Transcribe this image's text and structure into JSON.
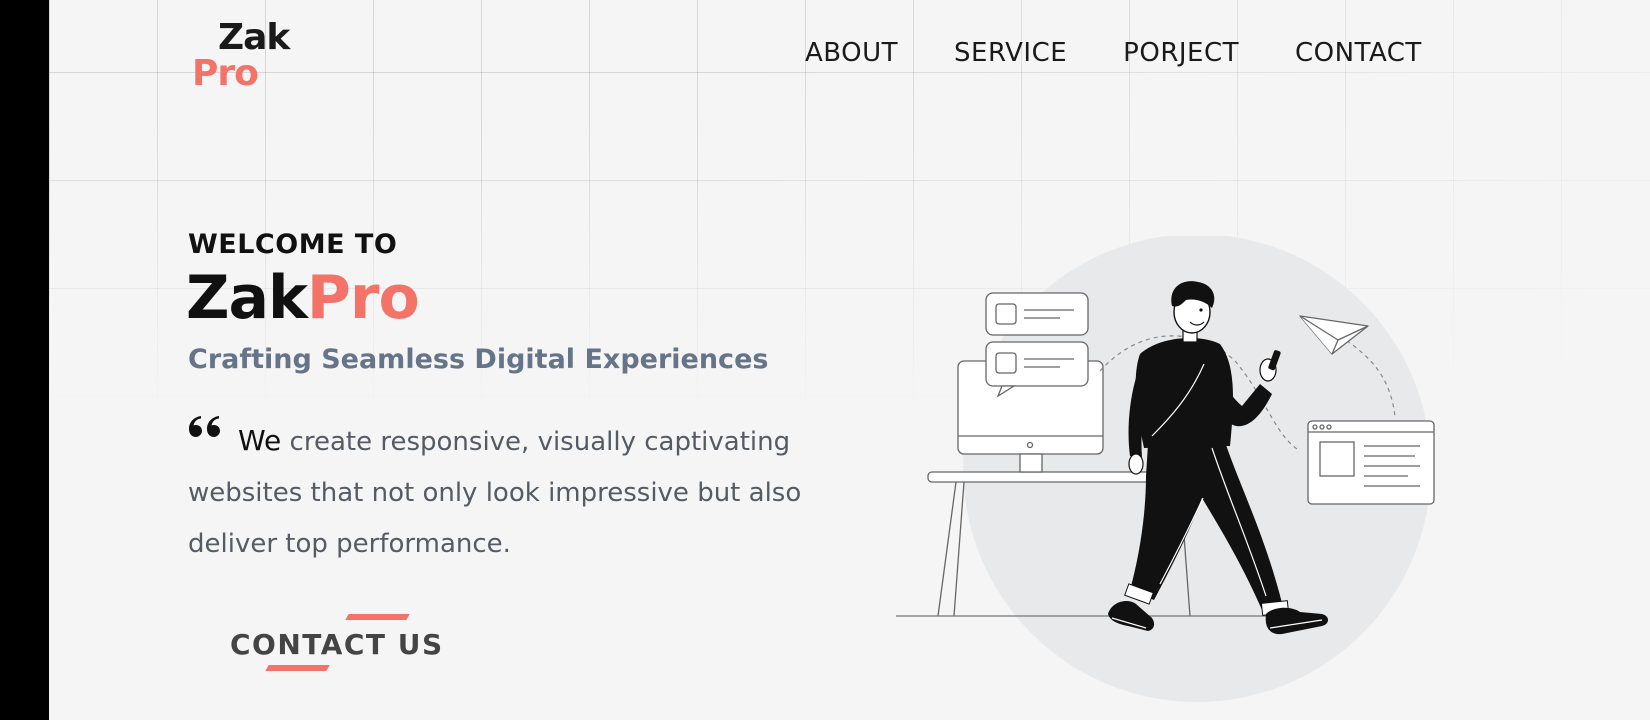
{
  "logo": {
    "line1": "Zak",
    "line2": "Pro",
    "accent_color": "#f37368"
  },
  "nav": {
    "items": [
      {
        "label": "ABOUT"
      },
      {
        "label": "SERVICE"
      },
      {
        "label": "PORJECT"
      },
      {
        "label": "CONTACT"
      }
    ]
  },
  "hero": {
    "welcome": "WELCOME TO",
    "brand_part1": "Zak",
    "brand_part2": "Pro",
    "tagline": "Crafting Seamless Digital Experiences",
    "quote_lead": "We",
    "quote_rest": " create responsive, visually captivating websites that not only look impressive but also deliver top performance.",
    "cta_label": "CONTACT US"
  },
  "colors": {
    "accent": "#f37368",
    "tagline": "#667489",
    "background": "#f5f5f5",
    "left_bar": "#000000"
  },
  "icons": {
    "quote": "quote-icon",
    "illustration": "man-walking-with-phone-illustration"
  }
}
